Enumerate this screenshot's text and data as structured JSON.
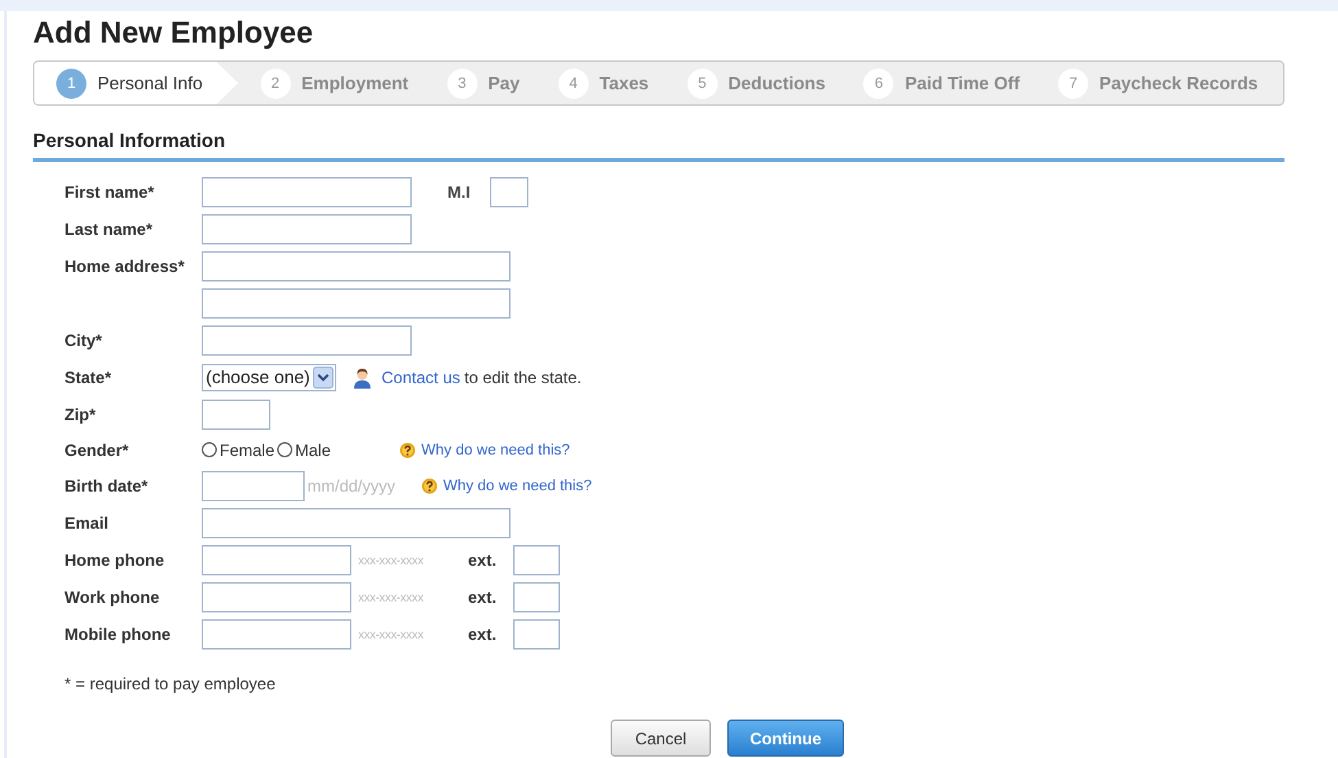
{
  "title": "Add New Employee",
  "steps": [
    {
      "number": "1",
      "label": "Personal Info",
      "selected": true
    },
    {
      "number": "2",
      "label": "Employment",
      "selected": false
    },
    {
      "number": "3",
      "label": "Pay",
      "selected": false
    },
    {
      "number": "4",
      "label": "Taxes",
      "selected": false
    },
    {
      "number": "5",
      "label": "Deductions",
      "selected": false
    },
    {
      "number": "6",
      "label": "Paid Time Off",
      "selected": false
    },
    {
      "number": "7",
      "label": "Paycheck Records",
      "selected": false
    }
  ],
  "section_title": "Personal Information",
  "rows": [
    {
      "kind": "name",
      "label": "First name*",
      "extra_label": "M.I"
    },
    {
      "kind": "text",
      "label": "Last name*"
    },
    {
      "kind": "wide",
      "label": "Home address*"
    },
    {
      "kind": "wide"
    },
    {
      "kind": "text",
      "label": "City*"
    },
    {
      "kind": "select",
      "label": "State*",
      "value": "(choose one)",
      "link": "Contact us",
      "note": "to edit the state."
    },
    {
      "kind": "short",
      "label": "Zip*"
    },
    {
      "kind": "radio",
      "label": "Gender*",
      "options": [
        {
          "label": "Female",
          "selected": false
        },
        {
          "label": "Male",
          "selected": false
        }
      ],
      "help": "Why do we need this?"
    },
    {
      "kind": "date",
      "label": "Birth date*",
      "format": "mm/dd/yyyy",
      "help": "Why do we need this?"
    },
    {
      "kind": "wide",
      "label": "Email"
    },
    {
      "kind": "phone",
      "label": "Home phone",
      "format": "xxx-xxx-xxxx",
      "ext_label": "ext."
    },
    {
      "kind": "phone",
      "label": "Work phone",
      "format": "xxx-xxx-xxxx",
      "ext_label": "ext."
    },
    {
      "kind": "phone",
      "label": "Mobile phone",
      "format": "xxx-xxx-xxxx",
      "ext_label": "ext."
    }
  ],
  "footnote": "* = required to pay employee",
  "buttons": [
    {
      "kind": "secondary",
      "label": "Cancel"
    },
    {
      "kind": "primary",
      "label": "Continue"
    }
  ]
}
